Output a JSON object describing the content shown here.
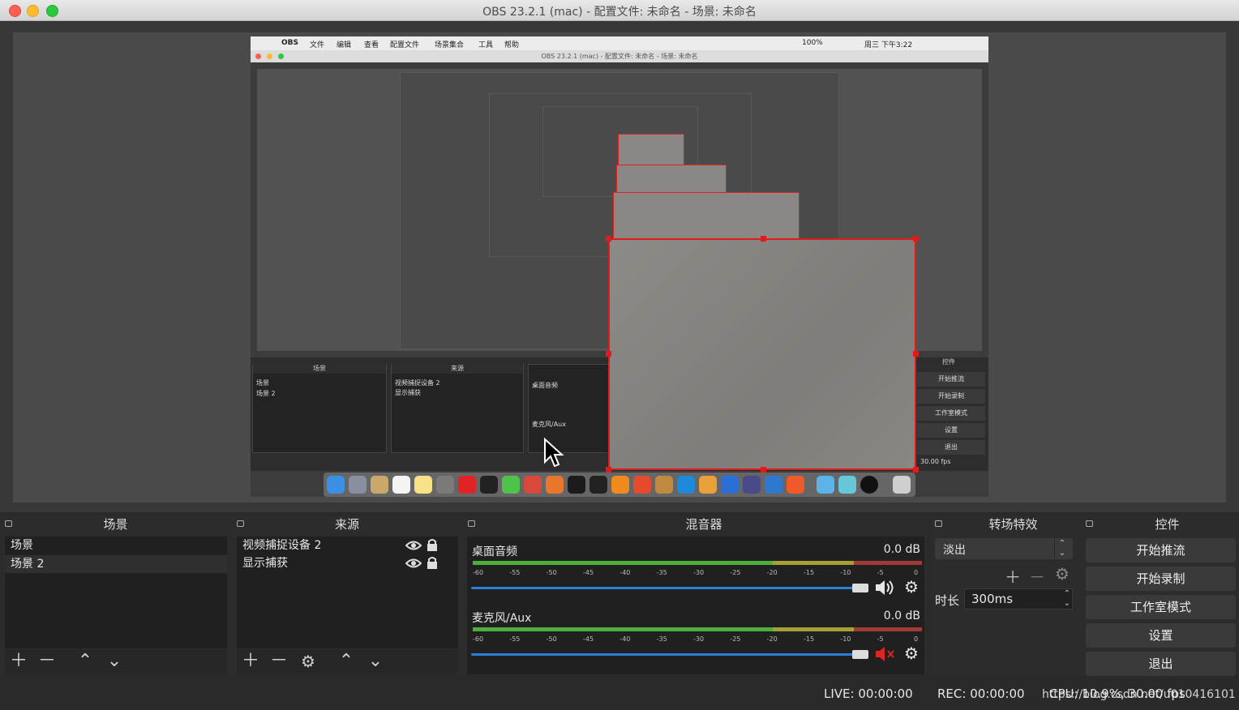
{
  "window": {
    "title": "OBS 23.2.1 (mac) - 配置文件: 未命名 - 场景: 未命名"
  },
  "capture": {
    "menubar": [
      "OBS",
      "文件",
      "编辑",
      "查看",
      "配置文件",
      "场景集合",
      "工具",
      "帮助"
    ],
    "status_right": "100%",
    "clock": "周三 下午3:22",
    "title": "OBS 23.2.1 (mac) - 配置文件: 未命名 - 场景: 未命名",
    "scenes_head": "场景",
    "sources_head": "来源",
    "controls_head": "控件",
    "scenes": [
      "场景",
      "场景 2"
    ],
    "sources": [
      "视频捕捉设备 2",
      "显示捕获"
    ],
    "mixer_tracks": [
      "桌面音频",
      "麦克风/Aux"
    ],
    "controls": [
      "开始推流",
      "开始录制",
      "工作室模式",
      "设置",
      "退出"
    ],
    "fps": "30.00 fps"
  },
  "panels": {
    "scenes": {
      "title": "场景",
      "items": [
        "场景",
        "场景 2"
      ]
    },
    "sources": {
      "title": "来源",
      "items": [
        "视频捕捉设备 2",
        "显示捕获"
      ]
    },
    "mixer": {
      "title": "混音器",
      "ticks": [
        "-60",
        "-55",
        "-50",
        "-45",
        "-40",
        "-35",
        "-30",
        "-25",
        "-20",
        "-15",
        "-10",
        "-5",
        "0"
      ],
      "tracks": [
        {
          "name": "桌面音频",
          "db": "0.0 dB",
          "muted": false
        },
        {
          "name": "麦克风/Aux",
          "db": "0.0 dB",
          "muted": true
        }
      ]
    },
    "transitions": {
      "title": "转场特效",
      "selected": "淡出",
      "duration_label": "时长",
      "duration_value": "300ms"
    },
    "controls": {
      "title": "控件",
      "buttons": [
        "开始推流",
        "开始录制",
        "工作室模式",
        "设置",
        "退出"
      ]
    }
  },
  "status": {
    "live": "LIVE: 00:00:00",
    "rec": "REC: 00:00:00",
    "cpu": "CPU: 10.9%, 30.00 fps",
    "watermark": "https://blog.csdn.net/u010416101"
  },
  "colors": {
    "meter_green": "#4caf3c",
    "meter_yellow": "#a6a037",
    "meter_red": "#a13a36",
    "slider_blue": "#2e7dd8",
    "selection_red": "#e01b1b"
  }
}
